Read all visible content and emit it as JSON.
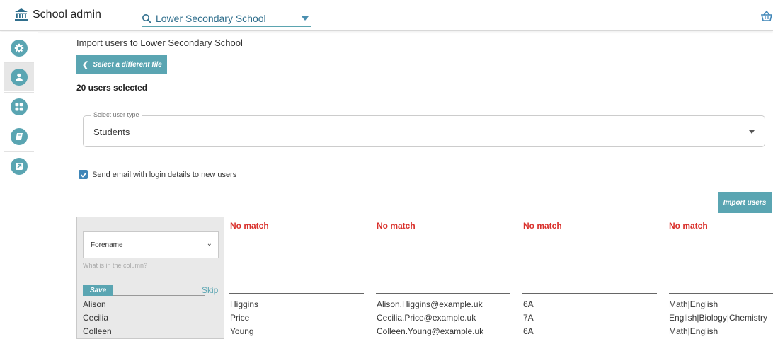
{
  "app": {
    "brand": "School admin",
    "school_select": "Lower Secondary School"
  },
  "sidebar": {
    "items": [
      {
        "icon": "gear-icon"
      },
      {
        "icon": "user-icon",
        "active": true
      },
      {
        "icon": "grid-icon"
      },
      {
        "icon": "book-icon"
      },
      {
        "icon": "external-link-icon"
      }
    ]
  },
  "main": {
    "title": "Import users to Lower Secondary School",
    "back_button": "Select a different file",
    "users_selected": "20 users selected",
    "user_type": {
      "legend": "Select user type",
      "value": "Students"
    },
    "send_email": {
      "checked": true,
      "label": "Send email with login details to new users"
    },
    "import_button": "Import users"
  },
  "mapping": {
    "first_column": {
      "select_value": "Forename",
      "help": "What is in the column?",
      "save": "Save",
      "skip": "Skip",
      "cells": [
        "Alison",
        "Cecilia",
        "Colleen"
      ]
    },
    "columns": [
      {
        "status": "No match",
        "cells": [
          "Higgins",
          "Price",
          "Young"
        ]
      },
      {
        "status": "No match",
        "cells": [
          "Alison.Higgins@example.uk",
          "Cecilia.Price@example.uk",
          "Colleen.Young@example.uk"
        ]
      },
      {
        "status": "No match",
        "cells": [
          "6A",
          "7A",
          "6A"
        ]
      },
      {
        "status": "No match",
        "cells": [
          "Math|English",
          "English|Biology|Chemistry",
          "Math|English"
        ]
      }
    ]
  },
  "colors": {
    "accent": "#5aa5b2",
    "no_match": "#d9302b",
    "link": "#2f6e8c"
  }
}
